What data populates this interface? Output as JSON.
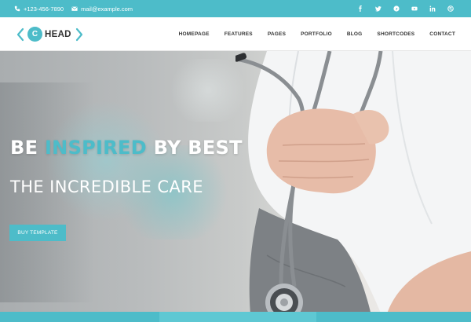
{
  "topbar": {
    "phone": "+123-456-7890",
    "email": "mail@example.com",
    "social": [
      "facebook-icon",
      "twitter-icon",
      "pinterest-icon",
      "youtube-icon",
      "linkedin-icon",
      "dribbble-icon"
    ]
  },
  "header": {
    "logo_letter": "C",
    "logo_name": "HEAD",
    "nav": [
      "HOMEPAGE",
      "FEATURES",
      "PAGES",
      "PORTFOLIO",
      "BLOG",
      "SHORTCODES",
      "CONTACT"
    ]
  },
  "hero": {
    "headline_part1": "BE ",
    "headline_accent": "INSPIRED",
    "headline_part2": " BY BEST",
    "subline": "THE INCREDIBLE CARE",
    "cta_label": "BUY TEMPLATE"
  },
  "colors": {
    "accent": "#4dbcc9",
    "topbar": "#4dbcc9",
    "text_dark": "#333333"
  }
}
